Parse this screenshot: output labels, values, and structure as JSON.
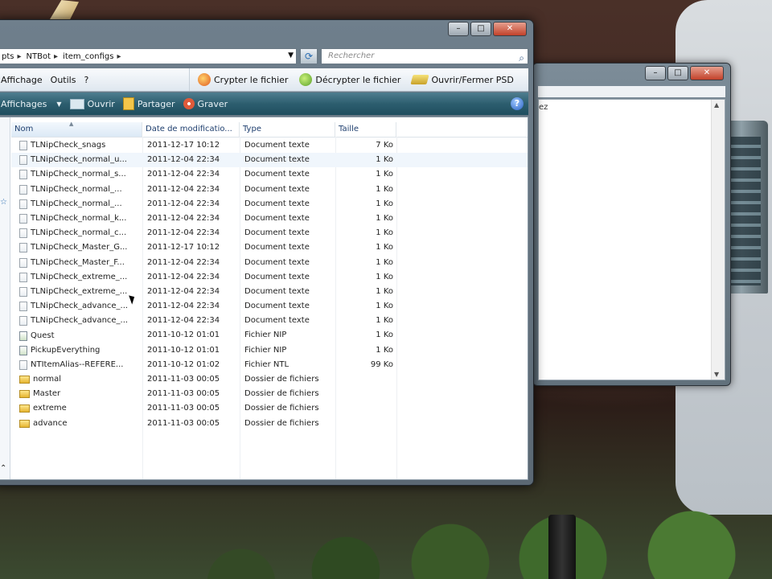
{
  "explorer": {
    "breadcrumb": [
      "pts",
      "NTBot",
      "item_configs"
    ],
    "search_placeholder": "Rechercher",
    "menu": [
      "Affichage",
      "Outils",
      "?"
    ],
    "tools": [
      "Crypter le fichier",
      "Décrypter le fichier",
      "Ouvrir/Fermer PSD"
    ],
    "commands": [
      "Affichages",
      "Ouvrir",
      "Partager",
      "Graver"
    ],
    "columns": [
      "Nom",
      "Date de modificatio...",
      "Type",
      "Taille"
    ],
    "files": [
      {
        "name": "TLNipCheck_snags",
        "date": "2011-12-17 10:12",
        "type": "Document texte",
        "size": "7 Ko",
        "icon": "text-file"
      },
      {
        "name": "TLNipCheck_normal_u...",
        "date": "2011-12-04 22:34",
        "type": "Document texte",
        "size": "1 Ko",
        "icon": "text-file"
      },
      {
        "name": "TLNipCheck_normal_s...",
        "date": "2011-12-04 22:34",
        "type": "Document texte",
        "size": "1 Ko",
        "icon": "text-file"
      },
      {
        "name": "TLNipCheck_normal_...",
        "date": "2011-12-04 22:34",
        "type": "Document texte",
        "size": "1 Ko",
        "icon": "text-file"
      },
      {
        "name": "TLNipCheck_normal_...",
        "date": "2011-12-04 22:34",
        "type": "Document texte",
        "size": "1 Ko",
        "icon": "text-file"
      },
      {
        "name": "TLNipCheck_normal_k...",
        "date": "2011-12-04 22:34",
        "type": "Document texte",
        "size": "1 Ko",
        "icon": "text-file"
      },
      {
        "name": "TLNipCheck_normal_c...",
        "date": "2011-12-04 22:34",
        "type": "Document texte",
        "size": "1 Ko",
        "icon": "text-file"
      },
      {
        "name": "TLNipCheck_Master_G...",
        "date": "2011-12-17 10:12",
        "type": "Document texte",
        "size": "1 Ko",
        "icon": "text-file"
      },
      {
        "name": "TLNipCheck_Master_F...",
        "date": "2011-12-04 22:34",
        "type": "Document texte",
        "size": "1 Ko",
        "icon": "text-file"
      },
      {
        "name": "TLNipCheck_extreme_...",
        "date": "2011-12-04 22:34",
        "type": "Document texte",
        "size": "1 Ko",
        "icon": "text-file"
      },
      {
        "name": "TLNipCheck_extreme_...",
        "date": "2011-12-04 22:34",
        "type": "Document texte",
        "size": "1 Ko",
        "icon": "text-file"
      },
      {
        "name": "TLNipCheck_advance_...",
        "date": "2011-12-04 22:34",
        "type": "Document texte",
        "size": "1 Ko",
        "icon": "text-file"
      },
      {
        "name": "TLNipCheck_advance_...",
        "date": "2011-12-04 22:34",
        "type": "Document texte",
        "size": "1 Ko",
        "icon": "text-file"
      },
      {
        "name": "Quest",
        "date": "2011-10-12 01:01",
        "type": "Fichier NIP",
        "size": "1 Ko",
        "icon": "nip-file"
      },
      {
        "name": "PickupEverything",
        "date": "2011-10-12 01:01",
        "type": "Fichier NIP",
        "size": "1 Ko",
        "icon": "nip-file"
      },
      {
        "name": "NTItemAlias--REFERE...",
        "date": "2011-10-12 01:02",
        "type": "Fichier NTL",
        "size": "99 Ko",
        "icon": "text-file"
      },
      {
        "name": "normal",
        "date": "2011-11-03 00:05",
        "type": "Dossier de fichiers",
        "size": "",
        "icon": "folder"
      },
      {
        "name": "Master",
        "date": "2011-11-03 00:05",
        "type": "Dossier de fichiers",
        "size": "",
        "icon": "folder"
      },
      {
        "name": "extreme",
        "date": "2011-11-03 00:05",
        "type": "Dossier de fichiers",
        "size": "",
        "icon": "folder"
      },
      {
        "name": "advance",
        "date": "2011-11-03 00:05",
        "type": "Dossier de fichiers",
        "size": "",
        "icon": "folder"
      }
    ]
  },
  "secondary_window": {
    "text": "ez"
  }
}
